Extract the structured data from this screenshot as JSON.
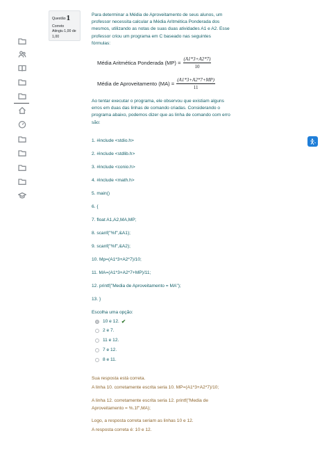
{
  "question_info": {
    "label": "Questão",
    "number": "1",
    "status": "Correto",
    "grade_line1": "Atingiu 1,00 de",
    "grade_line2": "1,00"
  },
  "intro": {
    "text": "Para determinar a Média de Aproveitamento de seus alunos, um professor necessita calcular a Média Aritmética Ponderada dos mesmos, utilizando as notas de suas duas atividades A1 e A2. Esse professor criou um programa em C baseado nas seguintes fórmulas:"
  },
  "formulas": [
    {
      "name": "Média Aritmética Ponderada (MP) =",
      "numerator": "(A1*3+A2*7)",
      "denominator": "10"
    },
    {
      "name": "Média de Aproveitamento (MA) =",
      "numerator": "(A1*3+A2*7+MP)",
      "denominator": "11"
    }
  ],
  "problem": {
    "text": "Ao tentar executar o programa, ele observou que existiam alguns erros em duas das linhas de comando criadas. Considerando o programa abaixo, podemos dizer que as linha de comando com erro são:"
  },
  "code_lines": [
    "1. #include <stdio.h>",
    "2. #include <stdlib.h>",
    "3. #include <conio.h>",
    "4. #include <math.h>",
    "5. main()",
    "6. {",
    "7. float A1,A2,MA,MP;",
    "8. scanf(\"%f\",&A1);",
    "9. scanf(\"%f\",&A2);",
    "10. Mp=(A1*3+A2*7)/10;",
    "11. MA=(A1*3+A2*7+MP)/11;",
    "12. printf(\"Media de Aproveitamento = MA\");",
    "13. }"
  ],
  "choices": {
    "label": "Escolha uma opção:",
    "options": [
      {
        "letter": "a.",
        "text": "10 e 12.",
        "selected": true
      },
      {
        "letter": "b.",
        "text": "2 e 7.",
        "selected": false
      },
      {
        "letter": "c.",
        "text": "11 e 12.",
        "selected": false
      },
      {
        "letter": "d.",
        "text": "7 e 12.",
        "selected": false
      },
      {
        "letter": "e.",
        "text": "8 e 11.",
        "selected": false
      }
    ]
  },
  "feedback": {
    "correct": "Sua resposta está correta.",
    "line1": "A linha 10. corretamente escrita seria 10. MP=(A1*3+A2*7)/10;",
    "line2a": "A linha 12. corretamente escrita seria 12. printf(\"Media de",
    "line2b": "Aproveitamento = %.1f\",MA);",
    "conclusion": "Logo, a resposta correta seriam as linhas 10 e 12.",
    "answer": "A resposta correta é: 10 e 12."
  },
  "icons": {
    "sidebar": [
      "folder-icon",
      "users-icon",
      "book-icon",
      "folder-icon",
      "folder-icon",
      "home-icon",
      "gauge-icon",
      "folder-icon",
      "folder-icon",
      "folder-icon",
      "folder-icon",
      "graduation-cap-icon"
    ],
    "float_button": "accessibility-icon"
  },
  "colors": {
    "text_teal": "#115e67",
    "feedback_brown": "#8e662e",
    "correct_green": "#357a32",
    "float_button_blue": "#1f7ed8"
  }
}
